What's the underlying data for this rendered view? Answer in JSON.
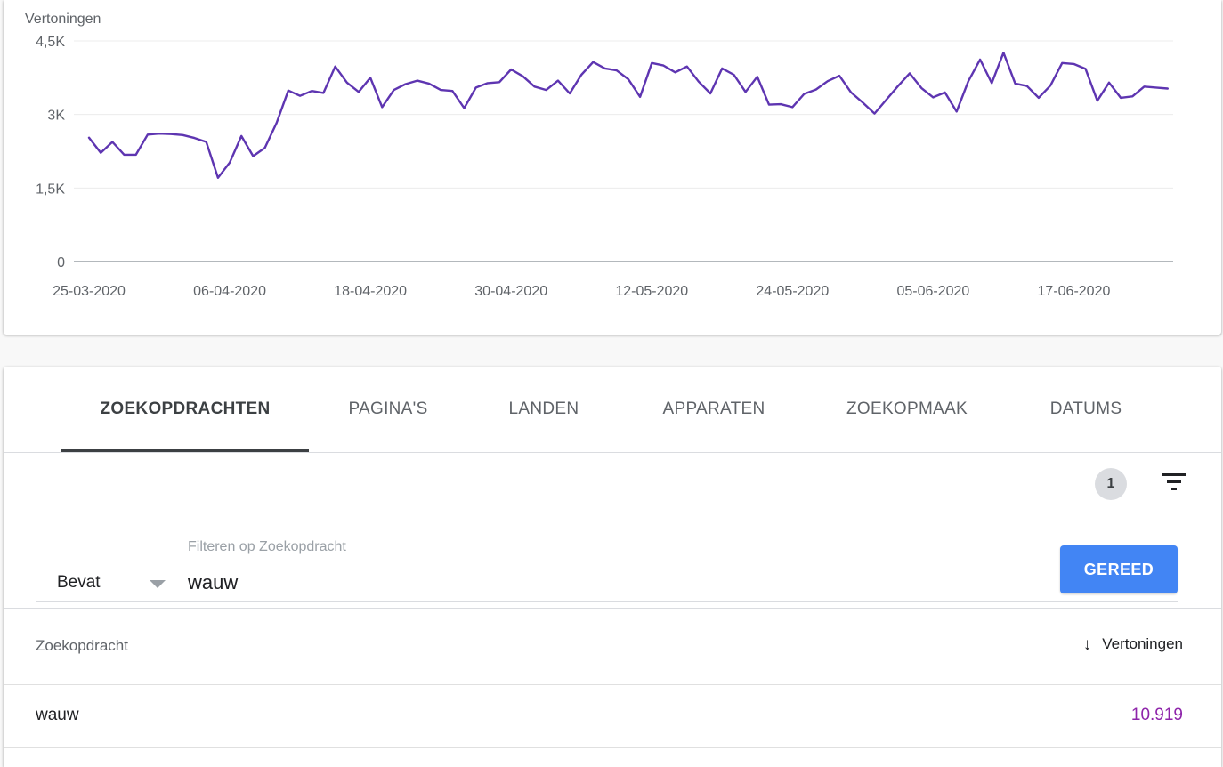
{
  "colors": {
    "series_line": "#5e35b1",
    "impressions_value": "#8e24aa",
    "done_button": "#4285f4"
  },
  "chart_data": {
    "type": "line",
    "ylabel": "Vertoningen",
    "ylim": [
      0,
      4500
    ],
    "yticks": [
      "0",
      "1,5K",
      "3K",
      "4,5K"
    ],
    "ytick_values": [
      0,
      1500,
      3000,
      4500
    ],
    "xticks": [
      "25-03-2020",
      "06-04-2020",
      "18-04-2020",
      "30-04-2020",
      "12-05-2020",
      "24-05-2020",
      "05-06-2020",
      "17-06-2020"
    ],
    "x_start": "2020-03-25",
    "x_end": "2020-06-22",
    "grid": true,
    "series": [
      {
        "values": [
          2525,
          2220,
          2440,
          2180,
          2180,
          2590,
          2610,
          2600,
          2580,
          2520,
          2440,
          1710,
          2020,
          2560,
          2150,
          2320,
          2830,
          3490,
          3380,
          3480,
          3440,
          3980,
          3650,
          3460,
          3750,
          3150,
          3500,
          3620,
          3690,
          3630,
          3500,
          3480,
          3130,
          3550,
          3640,
          3660,
          3920,
          3780,
          3570,
          3500,
          3690,
          3430,
          3810,
          4070,
          3940,
          3900,
          3720,
          3360,
          4050,
          4000,
          3860,
          3980,
          3670,
          3430,
          3940,
          3810,
          3460,
          3770,
          3200,
          3210,
          3150,
          3420,
          3510,
          3680,
          3790,
          3450,
          3240,
          3020,
          3300,
          3580,
          3840,
          3540,
          3350,
          3450,
          3060,
          3680,
          4120,
          3640,
          4260,
          3630,
          3580,
          3340,
          3590,
          4050,
          4030,
          3930,
          3280,
          3650,
          3340,
          3370,
          3570,
          3550,
          3530
        ]
      }
    ]
  },
  "tabs": [
    {
      "label": "ZOEKOPDRACHTEN",
      "active": true
    },
    {
      "label": "PAGINA'S"
    },
    {
      "label": "LANDEN"
    },
    {
      "label": "APPARATEN"
    },
    {
      "label": "ZOEKOPMAAK"
    },
    {
      "label": "DATUMS"
    }
  ],
  "filter": {
    "active_count": "1",
    "operator": "Bevat",
    "field_label": "Filteren op Zoekopdracht",
    "value": "wauw",
    "done_label": "GEREED"
  },
  "table": {
    "columns": {
      "query": "Zoekopdracht",
      "sort_icon": "arrow-down-icon",
      "impressions": "Vertoningen"
    },
    "rows": [
      {
        "query": "wauw",
        "impressions": "10.919"
      }
    ]
  }
}
